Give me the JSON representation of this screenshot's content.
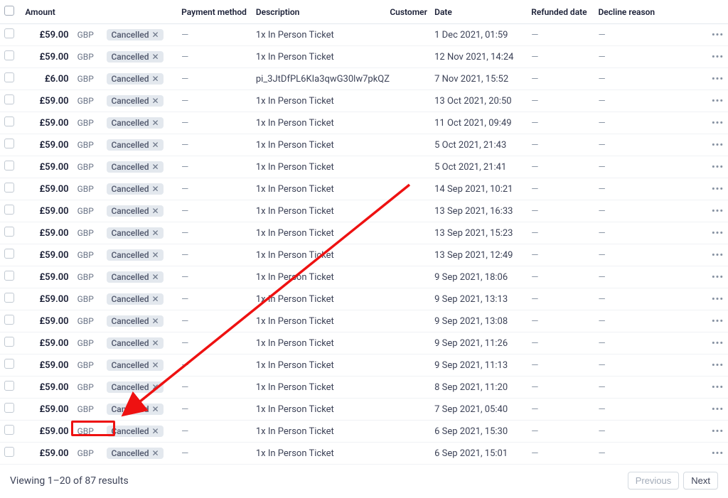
{
  "columns": {
    "amount": "Amount",
    "payment_method": "Payment method",
    "description": "Description",
    "customer": "Customer",
    "date": "Date",
    "refunded_date": "Refunded date",
    "decline_reason": "Decline reason"
  },
  "currency": "GBP",
  "status_label": "Cancelled",
  "dash": "—",
  "rows": [
    {
      "amount": "£59.00",
      "description": "1x In Person Ticket",
      "date": "1 Dec 2021, 01:59"
    },
    {
      "amount": "£59.00",
      "description": "1x In Person Ticket",
      "date": "12 Nov 2021, 14:24"
    },
    {
      "amount": "£6.00",
      "description": "pi_3JtDfPL6KIa3qwG30lw7pkQZ",
      "date": "7 Nov 2021, 15:52"
    },
    {
      "amount": "£59.00",
      "description": "1x In Person Ticket",
      "date": "13 Oct 2021, 20:50"
    },
    {
      "amount": "£59.00",
      "description": "1x In Person Ticket",
      "date": "11 Oct 2021, 09:49"
    },
    {
      "amount": "£59.00",
      "description": "1x In Person Ticket",
      "date": "5 Oct 2021, 21:43"
    },
    {
      "amount": "£59.00",
      "description": "1x In Person Ticket",
      "date": "5 Oct 2021, 21:41"
    },
    {
      "amount": "£59.00",
      "description": "1x In Person Ticket",
      "date": "14 Sep 2021, 10:21"
    },
    {
      "amount": "£59.00",
      "description": "1x In Person Ticket",
      "date": "13 Sep 2021, 16:33"
    },
    {
      "amount": "£59.00",
      "description": "1x In Person Ticket",
      "date": "13 Sep 2021, 15:23"
    },
    {
      "amount": "£59.00",
      "description": "1x In Person Ticket",
      "date": "13 Sep 2021, 12:49"
    },
    {
      "amount": "£59.00",
      "description": "1x In Person Ticket",
      "date": "9 Sep 2021, 18:06"
    },
    {
      "amount": "£59.00",
      "description": "1x In Person Ticket",
      "date": "9 Sep 2021, 13:13"
    },
    {
      "amount": "£59.00",
      "description": "1x In Person Ticket",
      "date": "9 Sep 2021, 13:08"
    },
    {
      "amount": "£59.00",
      "description": "1x In Person Ticket",
      "date": "9 Sep 2021, 11:26"
    },
    {
      "amount": "£59.00",
      "description": "1x In Person Ticket",
      "date": "9 Sep 2021, 11:13"
    },
    {
      "amount": "£59.00",
      "description": "1x In Person Ticket",
      "date": "8 Sep 2021, 11:20"
    },
    {
      "amount": "£59.00",
      "description": "1x In Person Ticket",
      "date": "7 Sep 2021, 05:40"
    },
    {
      "amount": "£59.00",
      "description": "1x In Person Ticket",
      "date": "6 Sep 2021, 15:30"
    },
    {
      "amount": "£59.00",
      "description": "1x In Person Ticket",
      "date": "6 Sep 2021, 15:01"
    }
  ],
  "footer": {
    "viewing_prefix": "Viewing 1–20 of ",
    "result_count_text": "87 results",
    "prev": "Previous",
    "next": "Next"
  }
}
